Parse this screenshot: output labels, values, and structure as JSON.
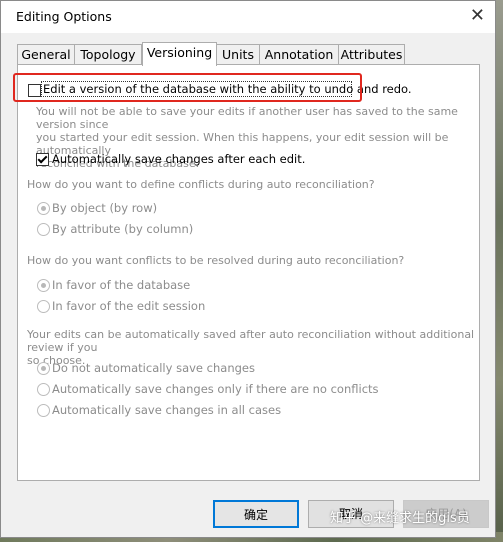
{
  "window": {
    "title": "Editing Options"
  },
  "tabs": [
    {
      "label": "General"
    },
    {
      "label": "Topology"
    },
    {
      "label": "Versioning"
    },
    {
      "label": "Units"
    },
    {
      "label": "Annotation"
    },
    {
      "label": "Attributes"
    }
  ],
  "active_tab": "Versioning",
  "versioning": {
    "undo_redo_label": "Edit a version of the database with the ability to undo and redo.",
    "undo_redo_checked": false,
    "undo_redo_desc_1": "You will not be able to save your edits if another user has saved to the same version since",
    "undo_redo_desc_2": "you started your edit session. When this happens, your edit session will be automatically",
    "undo_redo_desc_3": "reconciled with the database.",
    "autosave_label": "Automatically save changes after each edit.",
    "autosave_checked": true,
    "conflict_define_question": "How do you want to define conflicts during auto reconciliation?",
    "by_object": "By object (by row)",
    "by_attribute": "By attribute (by column)",
    "conflict_resolve_question": "How do you want conflicts to be resolved during auto reconciliation?",
    "favor_database": "In favor of the database",
    "favor_session": "In favor of the edit session",
    "save_after_reconcile_1": "Your edits can be automatically saved after auto reconciliation without additional review if you",
    "save_after_reconcile_2": "so choose.",
    "do_not_save": "Do not automatically save changes",
    "save_if_no_conflicts": "Automatically save changes only if there are no conflicts",
    "save_all_cases": "Automatically save changes in all cases"
  },
  "buttons": {
    "ok": "确定",
    "cancel": "取消",
    "apply": "应用(A)"
  },
  "watermark": "知乎 @来缝求生的gis员",
  "colors": {
    "highlight": "#e0281f",
    "focus_button": "#0078d7"
  }
}
